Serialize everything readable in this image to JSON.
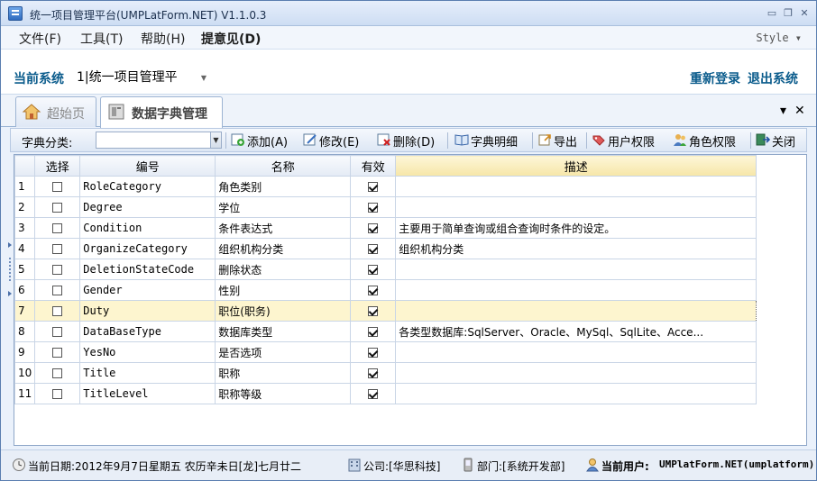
{
  "window": {
    "title": "统一项目管理平台(UMPLatForm.NET) V1.1.0.3"
  },
  "menu": {
    "items": [
      "文件(F)",
      "工具(T)",
      "帮助(H)",
      "提意见(D)"
    ],
    "style_label": "Style ▾"
  },
  "system": {
    "label": "当前系统",
    "selected": "1|统一项目管理平",
    "relogin": "重新登录",
    "logout": "退出系统"
  },
  "tabs": [
    {
      "label": "超始页",
      "active": false
    },
    {
      "label": "数据字典管理",
      "active": true
    }
  ],
  "tab_controls": {
    "pin": "▾",
    "close": "✕"
  },
  "toolbar": {
    "category_label": "字典分类:",
    "category_value": "",
    "buttons": [
      {
        "label": "添加(A)",
        "icon": "add-icon"
      },
      {
        "label": "修改(E)",
        "icon": "edit-icon"
      },
      {
        "label": "删除(D)",
        "icon": "delete-icon"
      },
      {
        "label": "字典明细",
        "icon": "book-icon"
      },
      {
        "label": "导出",
        "icon": "export-icon"
      },
      {
        "label": "用户权限",
        "icon": "user-permission-icon"
      },
      {
        "label": "角色权限",
        "icon": "role-permission-icon"
      },
      {
        "label": "关闭",
        "icon": "close-window-icon"
      }
    ]
  },
  "grid": {
    "columns": [
      "选择",
      "编号",
      "名称",
      "有效",
      "描述"
    ],
    "rows": [
      {
        "n": "1",
        "code": "RoleCategory",
        "name": "角色类别",
        "valid": true,
        "desc": ""
      },
      {
        "n": "2",
        "code": "Degree",
        "name": "学位",
        "valid": true,
        "desc": ""
      },
      {
        "n": "3",
        "code": "Condition",
        "name": "条件表达式",
        "valid": true,
        "desc": "主要用于简单查询或组合查询时条件的设定。"
      },
      {
        "n": "4",
        "code": "OrganizeCategory",
        "name": "组织机构分类",
        "valid": true,
        "desc": "组织机构分类"
      },
      {
        "n": "5",
        "code": "DeletionStateCode",
        "name": "删除状态",
        "valid": true,
        "desc": ""
      },
      {
        "n": "6",
        "code": "Gender",
        "name": "性别",
        "valid": true,
        "desc": ""
      },
      {
        "n": "7",
        "code": "Duty",
        "name": "职位(职务)",
        "valid": true,
        "desc": "",
        "selected": true
      },
      {
        "n": "8",
        "code": "DataBaseType",
        "name": "数据库类型",
        "valid": true,
        "desc": "各类型数据库:SqlServer、Oracle、MySql、SqlLite、Acce..."
      },
      {
        "n": "9",
        "code": "YesNo",
        "name": "是否选项",
        "valid": true,
        "desc": ""
      },
      {
        "n": "10",
        "code": "Title",
        "name": "职称",
        "valid": true,
        "desc": ""
      },
      {
        "n": "11",
        "code": "TitleLevel",
        "name": "职称等级",
        "valid": true,
        "desc": ""
      }
    ]
  },
  "status": {
    "date": "当前日期:2012年9月7日星期五 农历辛未日[龙]七月廿二",
    "company": "公司:[华思科技]",
    "department": "部门:[系统开发部]",
    "user_label": "当前用户:",
    "user_value": "UMPlatForm.NET(umplatform)"
  },
  "colors": {
    "accent": "#0b5c8c",
    "selected_row": "#fdf5cf",
    "desc_header": "#f6e6a8"
  }
}
